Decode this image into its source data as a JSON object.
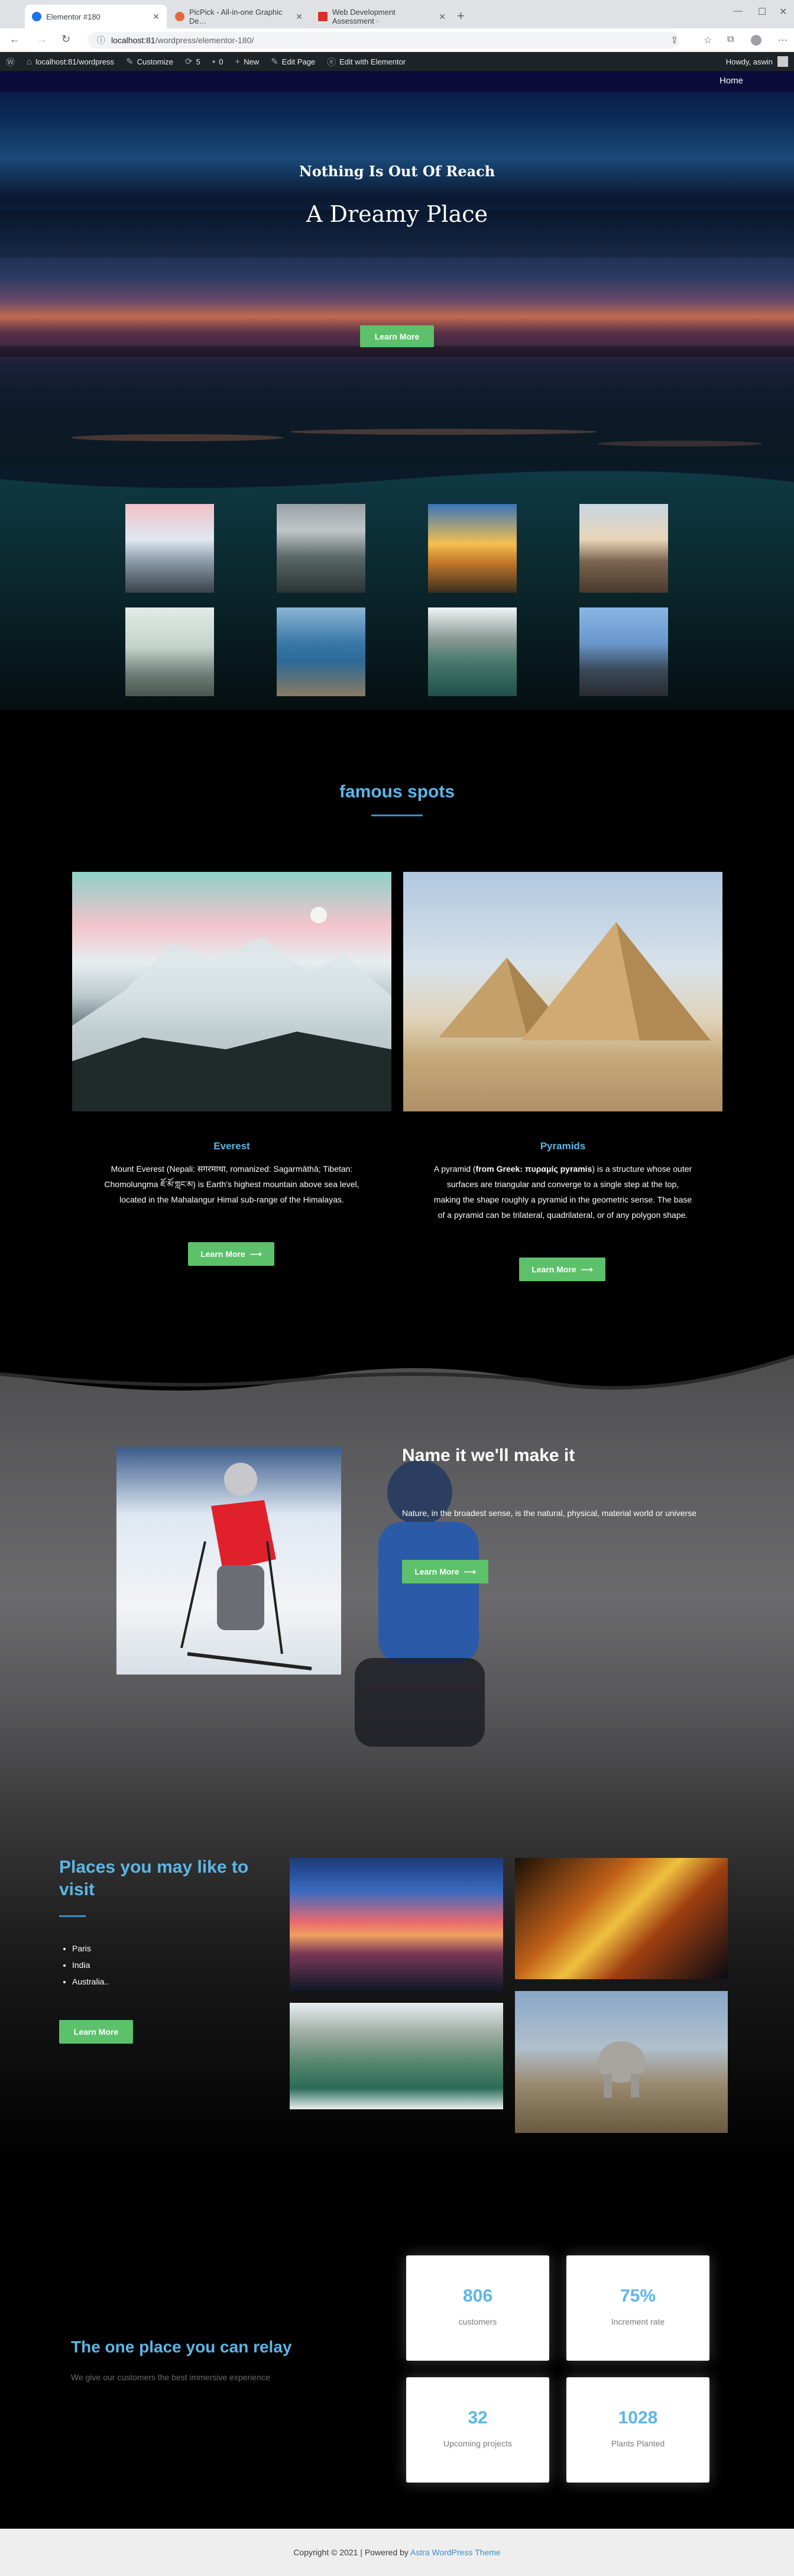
{
  "browser": {
    "tabs": [
      {
        "title": "Elementor #180",
        "favicon_color": "#1a73e8"
      },
      {
        "title": "PicPick - All-in-one Graphic De…",
        "favicon_color": "#e8673a"
      },
      {
        "title": "Web Development Assessment ·",
        "favicon_color": "#d93025"
      }
    ],
    "new_tab": "+",
    "url_host": "localhost:81",
    "url_path": "/wordpress/elementor-180/"
  },
  "adminbar": {
    "site": "localhost:81/wordpress",
    "customize": "Customize",
    "updates": "5",
    "comments": "0",
    "new": "New",
    "edit_page": "Edit Page",
    "edit_elementor": "Edit with Elementor",
    "howdy": "Howdy, aswin"
  },
  "hero": {
    "nav_home": "Home",
    "subtitle": "Nothing Is Out Of Reach",
    "title": "A Dreamy Place",
    "button": "Learn More"
  },
  "famous": {
    "title": "famous spots",
    "spots": [
      {
        "title": "Everest",
        "text": "Mount Everest (Nepali: सगरमाथा, romanized: Sagarmāthā; Tibetan: Chomolungma ཇོ་མོ་གླང་མ) is Earth's highest mountain above sea level, located in the Mahalangur Himal sub-range of the Himalayas.",
        "button": "Learn More"
      },
      {
        "title": "Pyramids",
        "text_before": "A pyramid (",
        "text_bold": "from Greek: πυραμίς pyramis",
        "text_after": ") is a structure whose outer surfaces are triangular and converge to a single step at the top, making the shape roughly a pyramid in the geometric sense. The base of a pyramid can be trilateral, quadrilateral, or of any polygon shape.",
        "button": "Learn More"
      }
    ]
  },
  "skier": {
    "title": "Name it we'll make it",
    "text": "Nature, in the broadest sense, is the natural, physical, material world or universe",
    "button": "Learn More"
  },
  "places": {
    "title": "Places you may like to visit",
    "items": [
      "Paris",
      "India",
      "Australia.."
    ],
    "button": "Learn More"
  },
  "stats": {
    "title": "The one place you can relay",
    "subtitle": "We give our customers the best immersive experience",
    "cards": [
      {
        "value": "806",
        "label": "customers"
      },
      {
        "value": "75%",
        "label": "Increment rate"
      },
      {
        "value": "32",
        "label": "Upcoming projects"
      },
      {
        "value": "1028",
        "label": "Plants Planted"
      }
    ]
  },
  "footer": {
    "text": "Copyright © 2021 | Powered by ",
    "link": "Astra WordPress Theme"
  },
  "colors": {
    "accent_blue": "#5db6e6",
    "button_green": "#5cc16a",
    "admin_bar": "#1d2327"
  }
}
